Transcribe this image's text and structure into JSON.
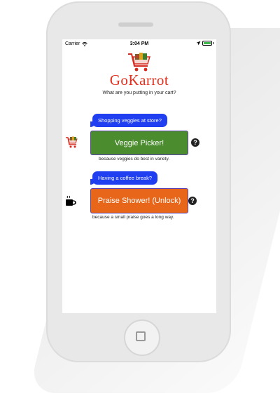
{
  "status_bar": {
    "carrier": "Carrier",
    "time": "3:04 PM"
  },
  "brand": {
    "name": "GoKarrot",
    "tagline": "What are you putting in your cart?"
  },
  "cards": [
    {
      "bubble": "Shopping veggies at store?",
      "button_label": "Veggie Picker!",
      "button_color": "#4a8c2e",
      "caption": "because veggies do best in variety.",
      "icon": "cart-icon"
    },
    {
      "bubble": "Having a coffee break?",
      "button_label": "Praise Shower! (Unlock)",
      "button_color": "#e8661a",
      "caption": "because a small praise goes a long way.",
      "icon": "coffee-icon"
    }
  ],
  "colors": {
    "bubble": "#1f3ff0",
    "brand": "#e0301e"
  }
}
